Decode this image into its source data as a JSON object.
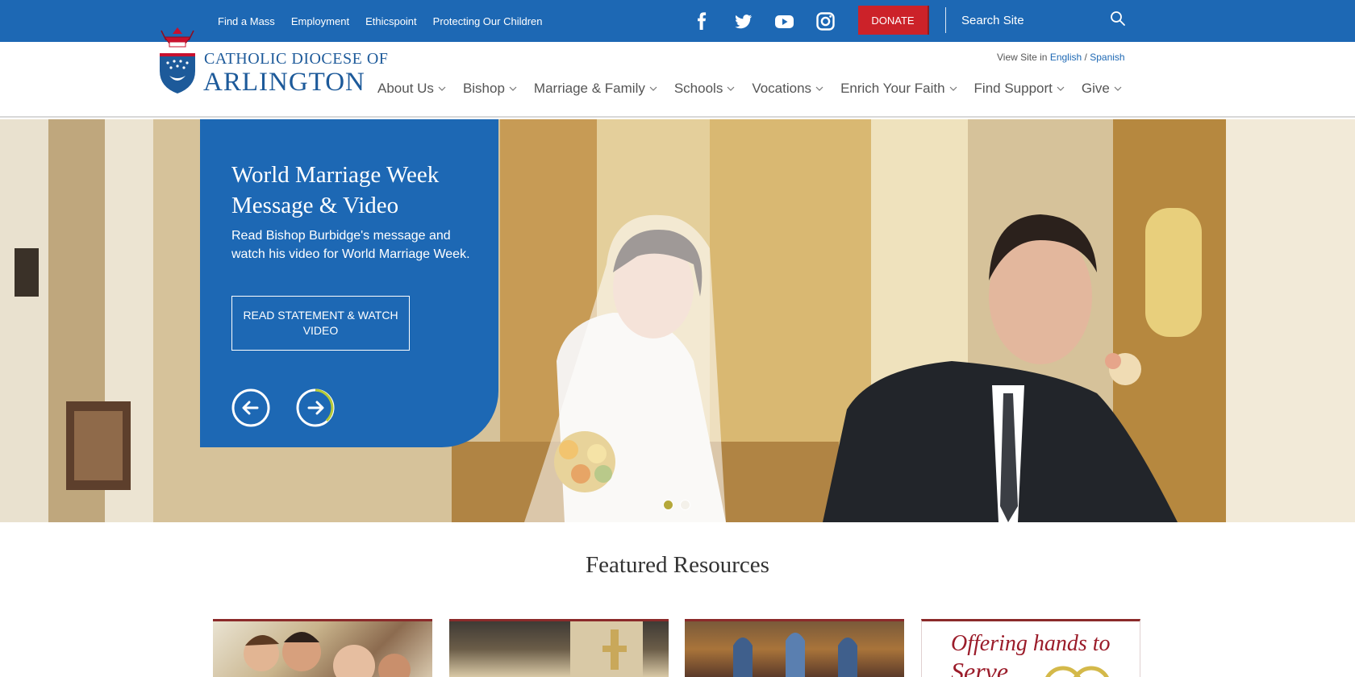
{
  "top_links": [
    "Find a Mass",
    "Employment",
    "Ethicspoint",
    "Protecting Our Children"
  ],
  "social_icons": [
    "facebook-icon",
    "twitter-icon",
    "youtube-icon",
    "instagram-icon"
  ],
  "donate_label": "DONATE",
  "search": {
    "placeholder": "Search Site"
  },
  "logo": {
    "line1": "CATHOLIC DIOCESE OF",
    "line2": "ARLINGTON"
  },
  "view_site": {
    "prefix": "View Site in",
    "english": "English",
    "separator": "/",
    "spanish": "Spanish"
  },
  "nav": [
    "About Us",
    "Bishop",
    "Marriage & Family",
    "Schools",
    "Vocations",
    "Enrich Your Faith",
    "Find Support",
    "Give"
  ],
  "hero": {
    "title": "World Marriage Week Message & Video",
    "subtitle": "Read Bishop Burbidge's message and watch his video for World Marriage Week.",
    "button": "READ STATEMENT & WATCH VIDEO",
    "active_slide": 1,
    "slide_count": 2
  },
  "featured": {
    "title": "Featured Resources",
    "card4_text": "Offering hands to",
    "card4_text2": "Serve"
  },
  "colors": {
    "brand_blue": "#1d68b4",
    "donate_red": "#cc2229",
    "accent_green": "#b5c936"
  }
}
